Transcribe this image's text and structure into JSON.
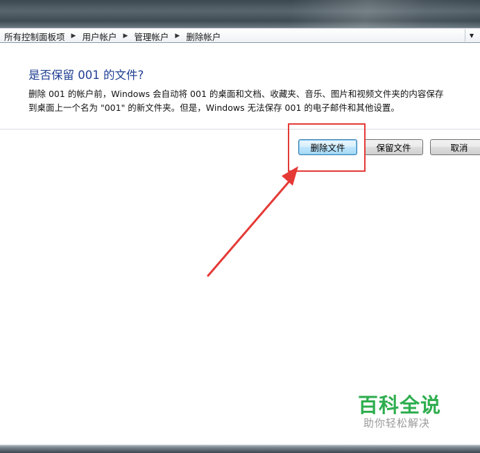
{
  "breadcrumb": {
    "items": [
      "所有控制面板项",
      "用户帐户",
      "管理帐户",
      "删除帐户"
    ]
  },
  "dialog": {
    "question": "是否保留 001 的文件?",
    "description_lines": [
      "删除 001 的帐户前，Windows 会自动将 001 的桌面和文档、收藏夹、音乐、图片和视频文件夹的内容保存",
      "到桌面上一个名为 \"001\" 的新文件夹。但是，Windows 无法保存 001 的电子邮件和其他设置。"
    ]
  },
  "buttons": {
    "delete_files": "删除文件",
    "keep_files": "保留文件",
    "cancel": "取消"
  },
  "watermark": {
    "name": "百科全说",
    "slogan": "助你轻松解决"
  },
  "colors": {
    "question_text": "#1e3f93",
    "annotation": "#e53935",
    "watermark_green": "#2fae4f"
  },
  "icons": {
    "breadcrumb_separator": "triangle-right-icon",
    "address_dropdown": "chevron-down-icon",
    "annotation_arrow": "red-arrow-icon"
  }
}
